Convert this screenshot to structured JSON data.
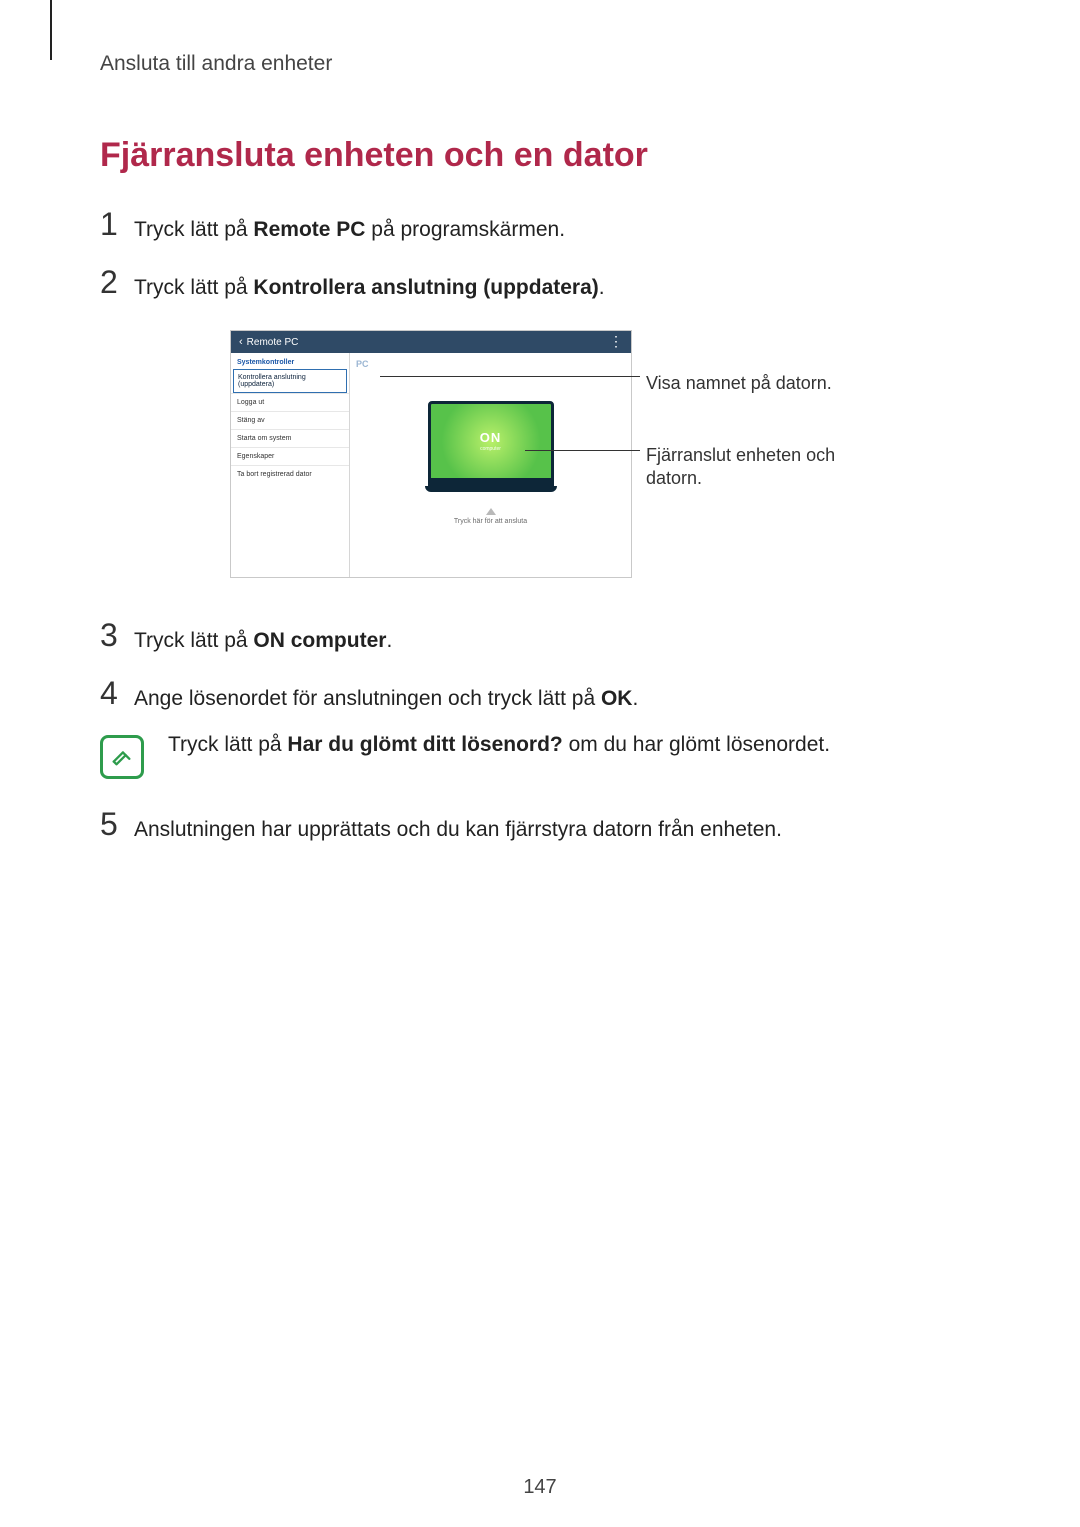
{
  "section_label": "Ansluta till andra enheter",
  "heading": "Fjärransluta enheten och en dator",
  "steps": {
    "s1_num": "1",
    "s1_pre": "Tryck lätt på ",
    "s1_bold": "Remote PC",
    "s1_post": " på programskärmen.",
    "s2_num": "2",
    "s2_pre": "Tryck lätt på ",
    "s2_bold": "Kontrollera anslutning (uppdatera)",
    "s2_post": ".",
    "s3_num": "3",
    "s3_pre": "Tryck lätt på ",
    "s3_bold": "ON computer",
    "s3_post": ".",
    "s4_num": "4",
    "s4_pre": "Ange lösenordet för anslutningen och tryck lätt på ",
    "s4_bold": "OK",
    "s4_post": ".",
    "s5_num": "5",
    "s5_text": "Anslutningen har upprättats och du kan fjärrstyra datorn från enheten."
  },
  "note": {
    "pre": "Tryck lätt på ",
    "bold": "Har du glömt ditt lösenord?",
    "post": " om du har glömt lösenordet."
  },
  "figure": {
    "header_title": "Remote PC",
    "sidebar_title": "Systemkontroller",
    "items": {
      "i0": "Kontrollera anslutning (uppdatera)",
      "i1": "Logga ut",
      "i2": "Stäng av",
      "i3": "Starta om system",
      "i4": "Egenskaper",
      "i5": "Ta bort registrerad dator"
    },
    "pc_label": "PC",
    "screen_on": "ON",
    "screen_sub": "computer",
    "connect_text": "Tryck här för att ansluta",
    "callout1": "Visa namnet på datorn.",
    "callout2": "Fjärranslut enheten och datorn."
  },
  "page_number": "147"
}
